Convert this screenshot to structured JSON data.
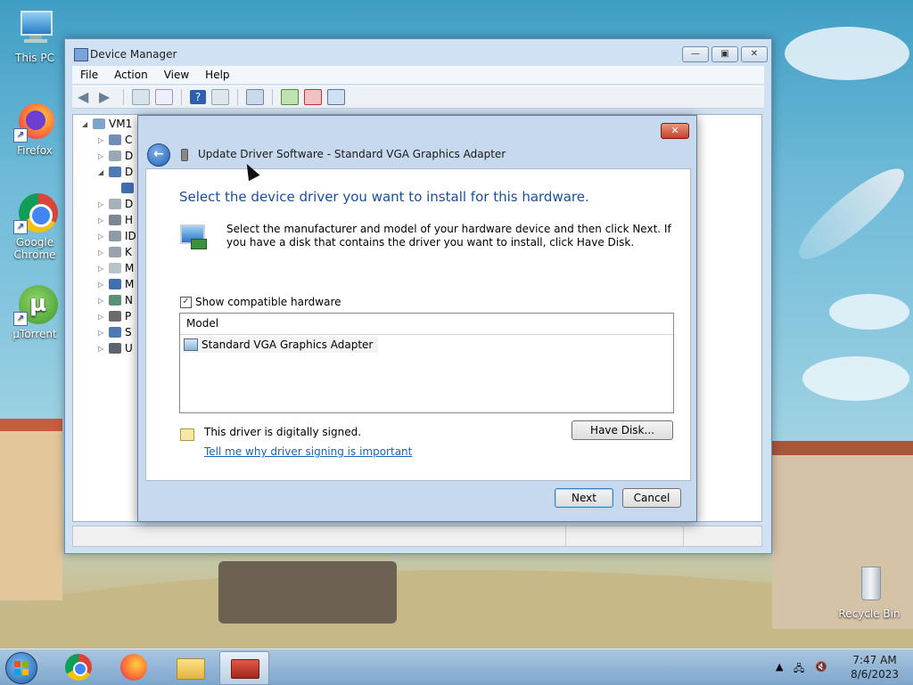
{
  "desktop": {
    "icons": [
      {
        "label": "This PC"
      },
      {
        "label": "Firefox"
      },
      {
        "label": "Google Chrome"
      },
      {
        "label": "µTorrent"
      },
      {
        "label": "Recycle Bin"
      }
    ]
  },
  "device_manager": {
    "title": "Device Manager",
    "menu": [
      "File",
      "Action",
      "View",
      "Help"
    ],
    "tree_root": "VM1",
    "tree_letters": [
      "C",
      "D",
      "D",
      "",
      "D",
      "H",
      "ID",
      "K",
      "M",
      "M",
      "N",
      "P",
      "S",
      "U"
    ]
  },
  "dialog": {
    "title": "Update Driver Software - Standard VGA Graphics Adapter",
    "heading": "Select the device driver you want to install for this hardware.",
    "instructions": "Select the manufacturer and model of your hardware device and then click Next. If you have a disk that contains the driver you want to install, click Have Disk.",
    "show_compatible_label": "Show compatible hardware",
    "show_compatible_checked": true,
    "list_header": "Model",
    "models": [
      "Standard VGA Graphics Adapter"
    ],
    "signed_text": "This driver is digitally signed.",
    "signing_link": "Tell me why driver signing is important",
    "have_disk_label": "Have Disk...",
    "next_label": "Next",
    "cancel_label": "Cancel"
  },
  "taskbar": {
    "time": "7:47 AM",
    "date": "8/6/2023"
  }
}
